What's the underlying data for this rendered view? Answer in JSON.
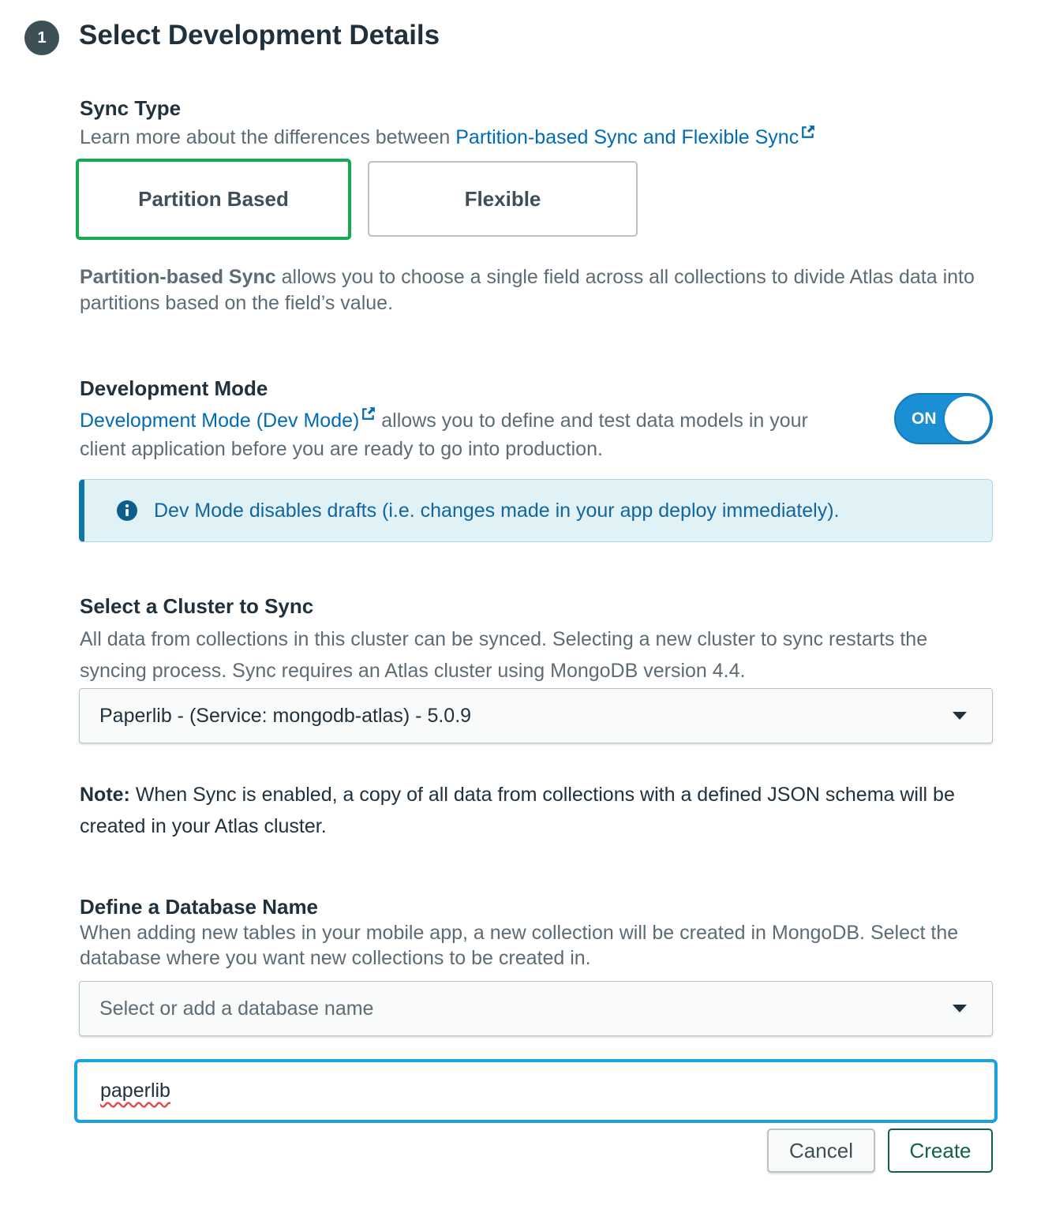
{
  "header": {
    "step_number": "1",
    "title": "Select Development Details"
  },
  "sync_type": {
    "title": "Sync Type",
    "desc_prefix": "Learn more about the differences between ",
    "desc_link": "Partition-based Sync and Flexible Sync",
    "options": [
      {
        "label": "Partition Based",
        "selected": true
      },
      {
        "label": "Flexible",
        "selected": false
      }
    ],
    "explain_bold": "Partition-based Sync",
    "explain_rest": " allows you to choose a single field across all collections to divide Atlas data into partitions based on the field’s value."
  },
  "dev_mode": {
    "title": "Development Mode",
    "link": "Development Mode (Dev Mode)",
    "desc_rest": " allows you to define and test data models in your client application before you are ready to go into production.",
    "toggle_label": "ON",
    "banner_text": "Dev Mode disables drafts (i.e. changes made in your app deploy immediately)."
  },
  "cluster": {
    "title": "Select a Cluster to Sync",
    "desc": "All data from collections in this cluster can be synced. Selecting a new cluster to sync restarts the syncing process. Sync requires an Atlas cluster using MongoDB version 4.4.",
    "selected_value": "Paperlib - (Service: mongodb-atlas) - 5.0.9"
  },
  "note": {
    "bold": "Note:",
    "text": " When Sync is enabled, a copy of all data from collections with a defined JSON schema will be created in your Atlas cluster."
  },
  "database": {
    "title": "Define a Database Name",
    "desc": "When adding new tables in your mobile app, a new collection will be created in MongoDB. Select the database where you want new collections to be created in.",
    "select_placeholder": "Select or add a database name",
    "input_value": "paperlib"
  },
  "actions": {
    "cancel_label": "Cancel",
    "create_label": "Create"
  },
  "colors": {
    "selected_border": "#13aa52",
    "link": "#016bb8",
    "toggle": "#1a8fd4",
    "focus": "#1a9fe0",
    "create": "#116149"
  }
}
